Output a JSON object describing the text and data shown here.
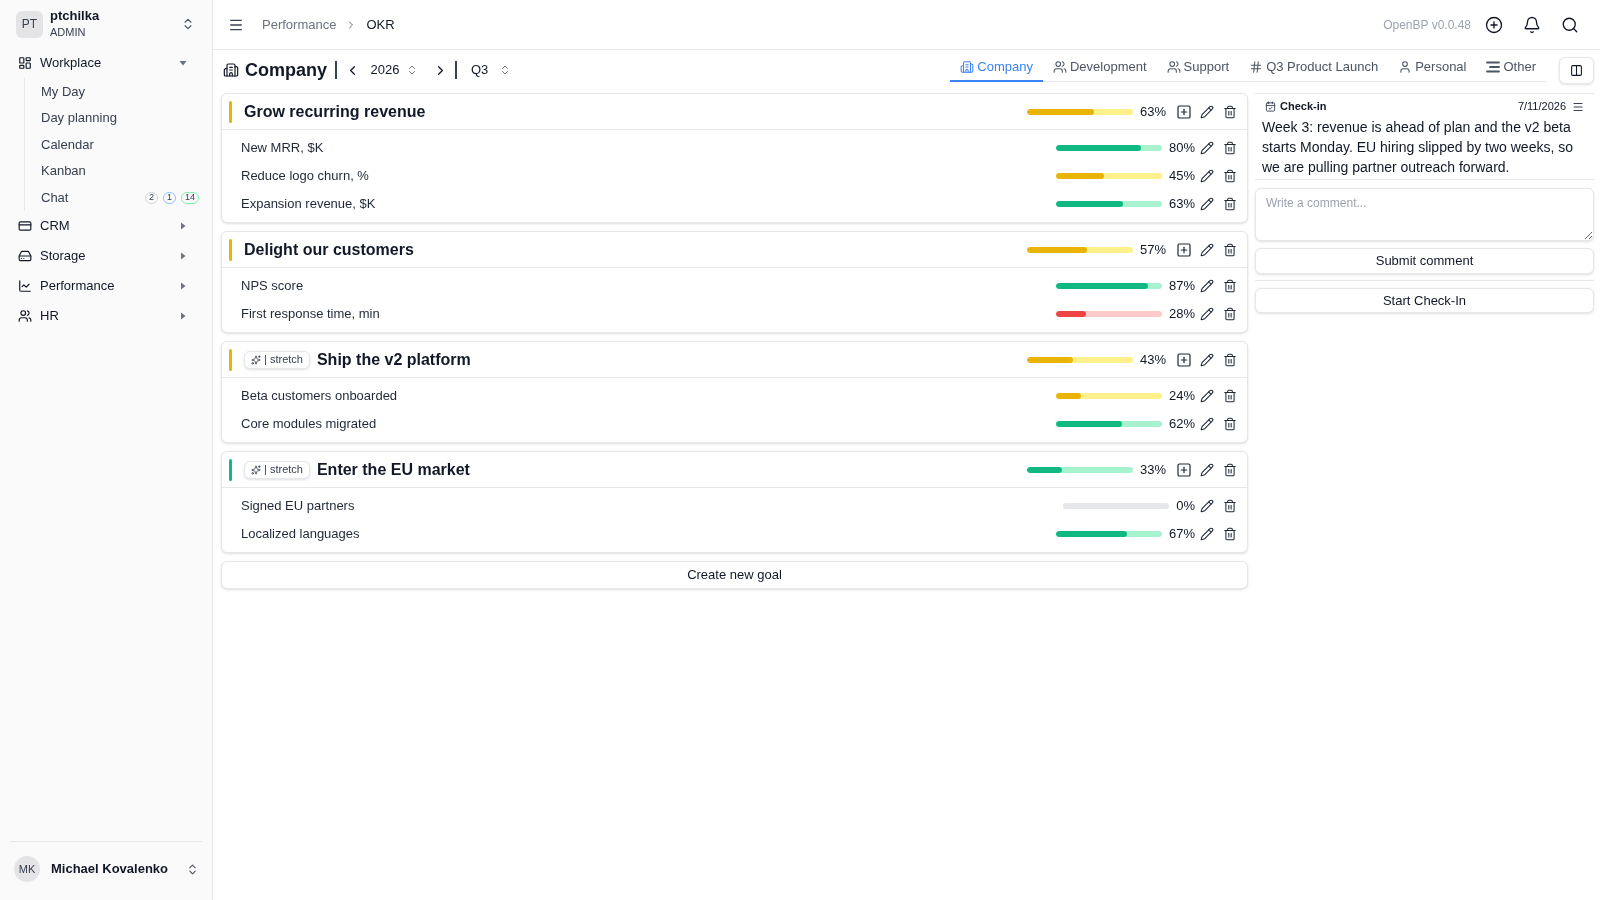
{
  "workspace": {
    "avatar": "PT",
    "name": "ptchilka",
    "role": "ADMIN"
  },
  "sidebar": {
    "sections": [
      {
        "label": "Workplace",
        "expanded": true,
        "children": [
          {
            "label": "My Day"
          },
          {
            "label": "Day planning"
          },
          {
            "label": "Calendar"
          },
          {
            "label": "Kanban"
          },
          {
            "label": "Chat",
            "badges": [
              {
                "text": "2",
                "color": "#d1d5db"
              },
              {
                "text": "1",
                "color": "#93c5fd"
              },
              {
                "text": "14",
                "color": "#86efac"
              }
            ]
          }
        ]
      },
      {
        "label": "CRM",
        "expanded": false
      },
      {
        "label": "Storage",
        "expanded": false
      },
      {
        "label": "Performance",
        "expanded": false
      },
      {
        "label": "HR",
        "expanded": false
      }
    ]
  },
  "user": {
    "avatar": "MK",
    "name": "Michael Kovalenko"
  },
  "header": {
    "breadcrumb": [
      "Performance",
      "OKR"
    ],
    "version": "OpenBP v0.0.48"
  },
  "toolbar": {
    "title": "Company",
    "year": "2026",
    "quarter": "Q3"
  },
  "tabs": [
    {
      "label": "Company",
      "selected": true
    },
    {
      "label": "Development",
      "selected": false
    },
    {
      "label": "Support",
      "selected": false
    },
    {
      "label": "Q3 Product Launch",
      "selected": false
    },
    {
      "label": "Personal",
      "selected": false
    },
    {
      "label": "Other",
      "selected": false
    }
  ],
  "goals": [
    {
      "title": "Grow recurring revenue",
      "color": "#eab308",
      "level": 0.63,
      "percent": "63%",
      "key_results": [
        {
          "label": "New MRR, $K",
          "color": "#10b981",
          "level": 0.8,
          "percent": "80%"
        },
        {
          "label": "Reduce logo churn, %",
          "color": "#eab308",
          "level": 0.45,
          "percent": "45%"
        },
        {
          "label": "Expansion revenue, $K",
          "color": "#10b981",
          "level": 0.63,
          "percent": "63%"
        }
      ]
    },
    {
      "title": "Delight our customers",
      "color": "#eab308",
      "level": 0.57,
      "percent": "57%",
      "key_results": [
        {
          "label": "NPS score",
          "color": "#10b981",
          "level": 0.87,
          "percent": "87%"
        },
        {
          "label": "First response time, min",
          "color": "#ef4444",
          "level": 0.28,
          "percent": "28%"
        }
      ]
    },
    {
      "title": "Ship the v2 platform",
      "tag": "| stretch",
      "color": "#eab308",
      "level": 0.43,
      "percent": "43%",
      "key_results": [
        {
          "label": "Beta customers onboarded",
          "color": "#eab308",
          "level": 0.24,
          "percent": "24%"
        },
        {
          "label": "Core modules migrated",
          "color": "#10b981",
          "level": 0.62,
          "percent": "62%"
        }
      ]
    },
    {
      "title": "Enter the EU market",
      "tag": "| stretch",
      "color": "#10b981",
      "level": 0.33,
      "percent": "33%",
      "key_results": [
        {
          "label": "Signed EU partners",
          "level": 0,
          "percent": "0%"
        },
        {
          "label": "Localized languages",
          "color": "#10b981",
          "level": 0.67,
          "percent": "67%"
        }
      ]
    }
  ],
  "create_goal_button": "Create new goal",
  "checkin": {
    "label": "Check-in",
    "date": "7/11/2026",
    "text": "Week 3: revenue is ahead of plan and the v2 beta starts Monday. EU hiring slipped by two weeks, so we are pulling partner outreach forward."
  },
  "comment": {
    "placeholder": "Write a comment...",
    "submit": "Submit comment"
  },
  "start_checkin_button": "Start Check-In"
}
